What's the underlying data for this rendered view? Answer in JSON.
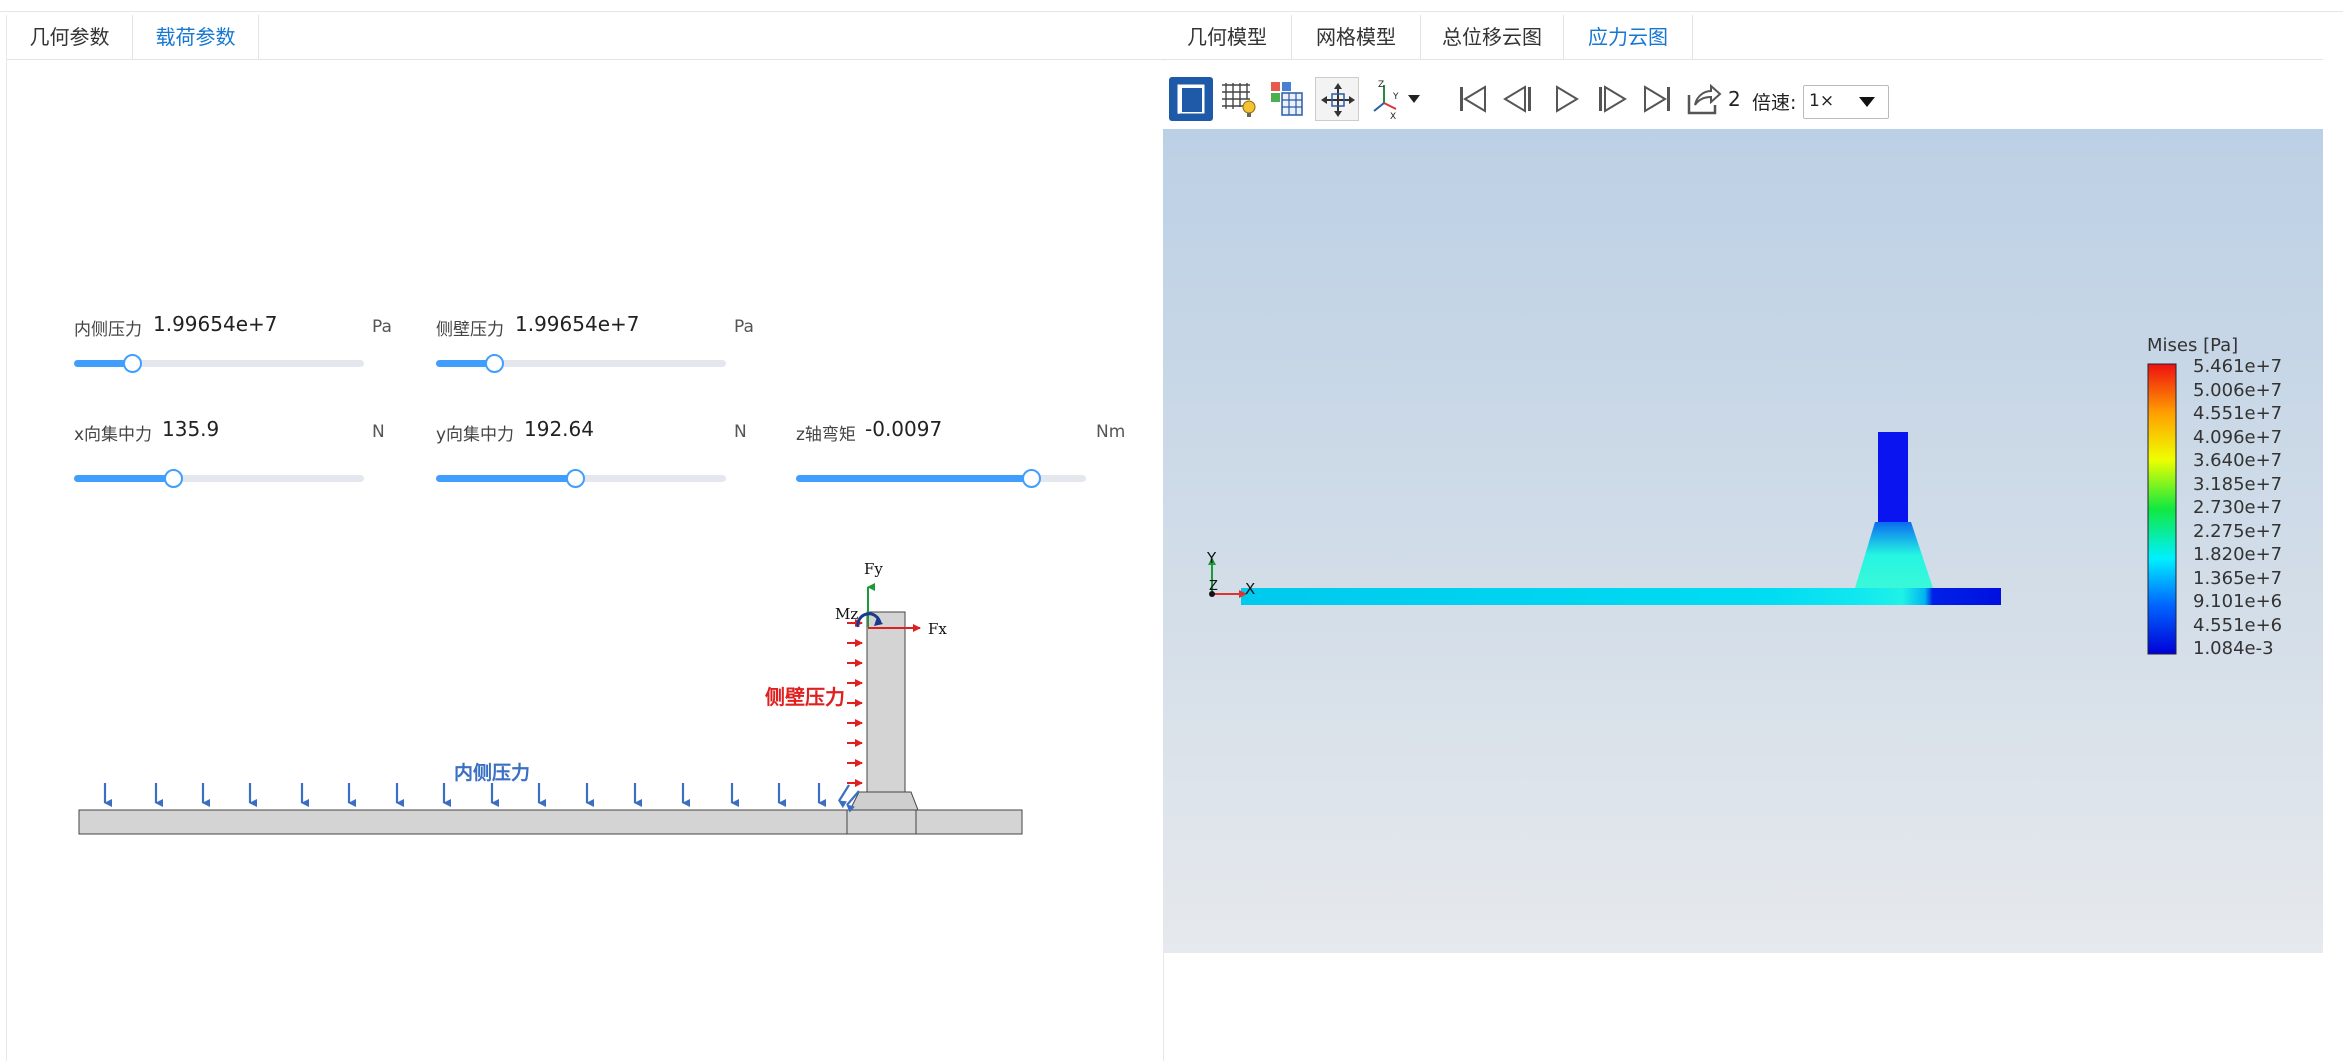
{
  "left_tabs": [
    {
      "label": "几何参数"
    },
    {
      "label": "载荷参数"
    }
  ],
  "right_tabs": [
    {
      "label": "几何模型"
    },
    {
      "label": "网格模型"
    },
    {
      "label": "总位移云图"
    },
    {
      "label": "应力云图"
    }
  ],
  "sliders": [
    {
      "label": "内侧压力",
      "value": "1.99654e+7",
      "unit": "Pa",
      "level": 0.2
    },
    {
      "label": "侧壁压力",
      "value": "1.99654e+7",
      "unit": "Pa",
      "level": 0.2
    },
    {
      "label": "x向集中力",
      "value": "135.9",
      "unit": "N",
      "level": 0.34
    },
    {
      "label": "y向集中力",
      "value": "192.64",
      "unit": "N",
      "level": 0.48
    },
    {
      "label": "z轴弯矩",
      "value": "-0.0097",
      "unit": "Nm",
      "level": 0.81
    }
  ],
  "diagram": {
    "fy": "Fy",
    "fx": "Fx",
    "mz": "Mz",
    "side_pressure": "侧壁压力",
    "inner_pressure": "内侧压力"
  },
  "toolbar": {
    "icons": [
      "solid-view-icon",
      "wireframe-probe-icon",
      "mesh-layers-icon",
      "fit-view-icon",
      "axes-orientation-icon",
      "first-frame-icon",
      "prev-frame-icon",
      "play-icon",
      "next-frame-icon",
      "last-frame-icon",
      "export-icon"
    ],
    "frame": "2",
    "speed_label": "倍速:",
    "speed_value": "1×"
  },
  "colorbar": {
    "title": "Mises [Pa]",
    "labels": [
      "5.461e+7",
      "5.006e+7",
      "4.551e+7",
      "4.096e+7",
      "3.640e+7",
      "3.185e+7",
      "2.730e+7",
      "2.275e+7",
      "1.820e+7",
      "1.365e+7",
      "9.101e+6",
      "4.551e+6",
      "1.084e-3"
    ]
  },
  "triad": {
    "x": "X",
    "y": "Y",
    "z": "Z"
  },
  "colors": {
    "accent": "#1677d2",
    "slider": "#409eff",
    "pressure_blue": "#3a6fc4",
    "pressure_red": "#e02020"
  }
}
